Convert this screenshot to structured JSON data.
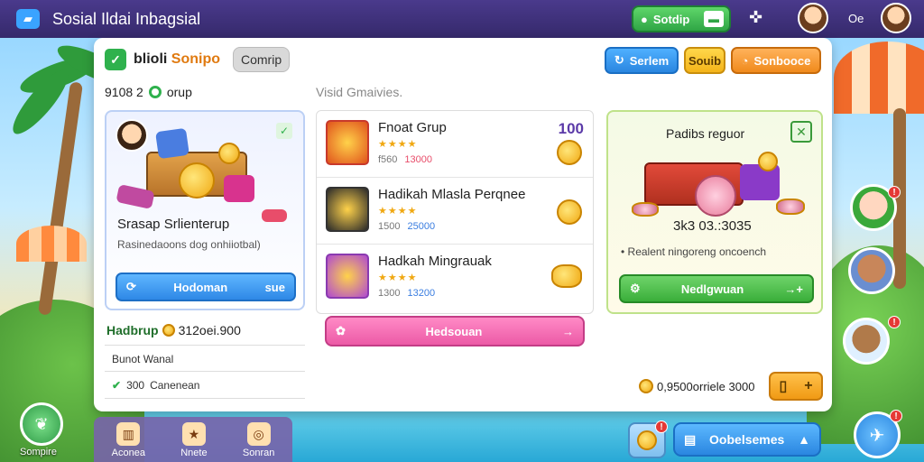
{
  "header": {
    "app_title": "Sosial Ildai Inbagsial",
    "action_button": "Sotdip",
    "right_text": "Oe"
  },
  "panel": {
    "title_prefix": "blioli",
    "title_accent": "Sonipo",
    "chip": "Comrip",
    "btn_blue": "Serlem",
    "btn_yellow": "Souib",
    "btn_orange": "Sonbooce",
    "left_subtitle": "9108 2",
    "left_subtitle_suffix": "orup",
    "middle_subtitle": "Visid Gmaivies."
  },
  "featured_card": {
    "title": "Srasap Srlienterup",
    "description": "Rasinedaoons dog onhiiotbal)",
    "button": "Hodoman",
    "button_suffix": "sue"
  },
  "summary": {
    "title_prefix": "Hadbrup",
    "title_value": "312oei.900",
    "row1": "Bunot Wanal",
    "row2_value": "300",
    "row2_label": "Canenean"
  },
  "list": {
    "items": [
      {
        "name": "Fnoat Grup",
        "stars": "★★★★",
        "meta_a": "f560",
        "meta_b": "13000",
        "score": "100"
      },
      {
        "name": "Hadikah Mlasla Perqnee",
        "stars": "★★★★",
        "meta_a": "1500",
        "meta_b": "25000",
        "score": ""
      },
      {
        "name": "Hadkah Mingrauak",
        "stars": "★★★★",
        "meta_a": "1300",
        "meta_b": "13200",
        "score": ""
      }
    ],
    "button": "Hedsouan",
    "button_suffix": "→"
  },
  "reward_card": {
    "title": "Padibs reguor",
    "amount": "3k3 03.:3035",
    "description": "• Realent ningoreng oncoench",
    "button": "Nedlgwuan",
    "button_suffix": "→+"
  },
  "footer": {
    "balance": "0,9500orriele 3000",
    "plus_button": "+"
  },
  "bottom_tabs": [
    {
      "label": "Aconea",
      "icon": "▥"
    },
    {
      "label": "Nnete",
      "icon": "★"
    },
    {
      "label": "Sonran",
      "icon": "◎"
    }
  ],
  "corner_left_label": "Sompire",
  "bottom_button": "Oobelsemes",
  "colors": {
    "topbar": "#35296b",
    "panel": "#ffffff",
    "green": "#2fb14d",
    "blue": "#2a86e0",
    "orange": "#f08a1c",
    "pink": "#ec5aa6"
  }
}
